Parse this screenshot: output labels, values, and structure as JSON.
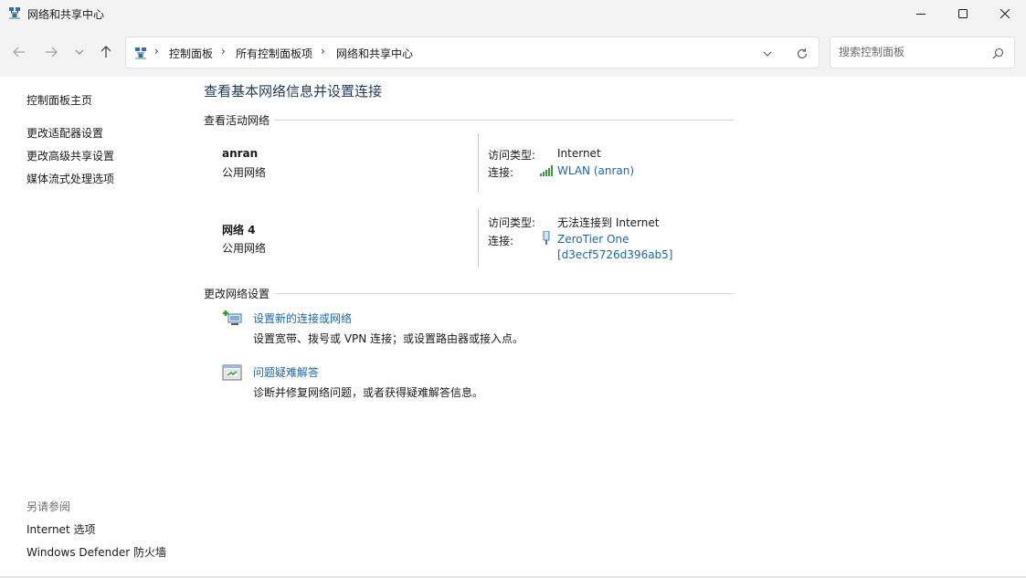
{
  "window": {
    "title": "网络和共享中心",
    "icons": {
      "app": "network-icon",
      "minimize": "minimize-icon",
      "maximize": "maximize-icon",
      "close": "close-icon"
    }
  },
  "address_bar": {
    "breadcrumbs": [
      "控制面板",
      "所有控制面板项",
      "网络和共享中心"
    ],
    "separator": "›",
    "icons": {
      "back": "arrow-left-icon",
      "forward": "arrow-right-icon",
      "recent": "chevron-down-icon",
      "up": "arrow-up-icon",
      "dropdown": "chevron-down-icon",
      "refresh": "refresh-icon"
    }
  },
  "search": {
    "placeholder": "搜索控制面板",
    "value": "",
    "icon": "search-icon"
  },
  "sidebar": {
    "links": [
      "控制面板主页",
      "更改适配器设置",
      "更改高级共享设置",
      "媒体流式处理选项"
    ],
    "see_also_label": "另请参阅",
    "see_also_links": [
      "Internet 选项",
      "Windows Defender 防火墙"
    ]
  },
  "main": {
    "title": "查看基本网络信息并设置连接",
    "active_section_label": "查看活动网络",
    "networks": [
      {
        "name": "anran",
        "type": "公用网络",
        "access_label": "访问类型:",
        "access_value": "Internet",
        "connection_label": "连接:",
        "connection_icon": "wifi-signal-icon",
        "connection_value": "WLAN (anran)"
      },
      {
        "name": "网络 4",
        "type": "公用网络",
        "access_label": "访问类型:",
        "access_value": "无法连接到 Internet",
        "connection_label": "连接:",
        "connection_icon": "network-adapter-icon",
        "connection_value_line1": "ZeroTier One",
        "connection_value_line2": "[d3ecf5726d396ab5]"
      }
    ],
    "change_section_label": "更改网络设置",
    "tasks": [
      {
        "icon": "new-connection-icon",
        "link": "设置新的连接或网络",
        "desc": "设置宽带、拨号或 VPN 连接；或设置路由器或接入点。"
      },
      {
        "icon": "troubleshoot-icon",
        "link": "问题疑难解答",
        "desc": "诊断并修复网络问题，或者获得疑难解答信息。"
      }
    ]
  },
  "colors": {
    "link": "#1a67a8",
    "title": "#1e395b",
    "muted": "#6d6d6d",
    "chrome": "#f3f3f3"
  }
}
